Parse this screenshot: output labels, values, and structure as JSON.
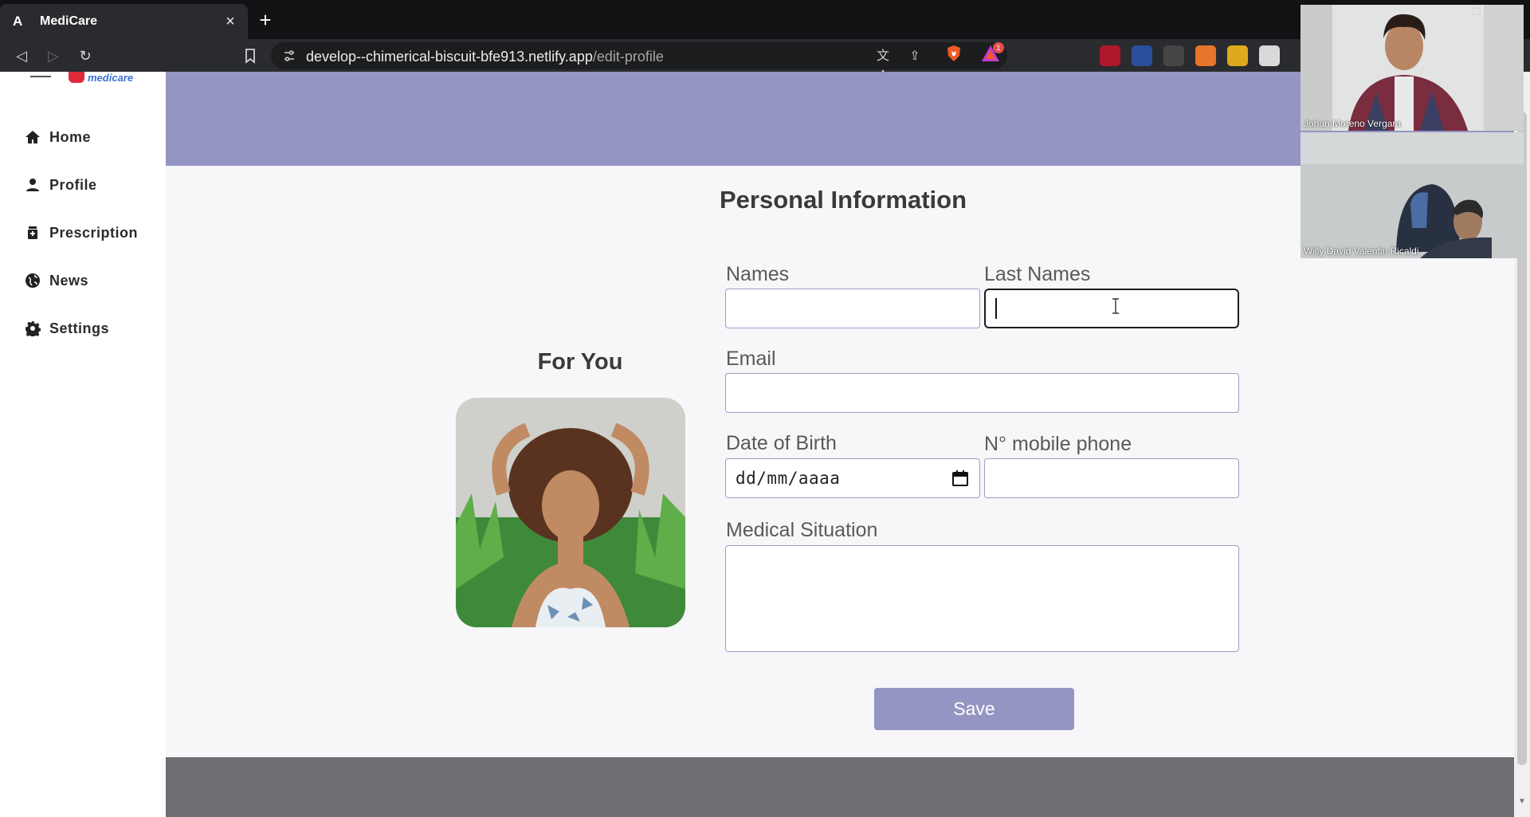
{
  "browser": {
    "tab": {
      "favicon": "A",
      "title": "MediCare",
      "close": "×"
    },
    "new_tab": "+",
    "nav": {
      "back": "◁",
      "forward": "▷",
      "reload": "↻"
    },
    "url": {
      "host": "develop--chimerical-biscuit-bfe913.netlify.app",
      "path": "/edit-profile"
    },
    "actions": {
      "translate": "文A",
      "share": "⇪"
    },
    "rewards_badge": "1"
  },
  "app": {
    "logo_text": "medicare",
    "sidebar": {
      "items": [
        {
          "label": "Home",
          "icon": "home-icon"
        },
        {
          "label": "Profile",
          "icon": "person-icon"
        },
        {
          "label": "Prescription",
          "icon": "prescription-icon"
        },
        {
          "label": "News",
          "icon": "globe-icon"
        },
        {
          "label": "Settings",
          "icon": "gear-icon"
        }
      ]
    },
    "section_title": "Personal Information",
    "for_you": {
      "title": "For You"
    },
    "form": {
      "names_label": "Names",
      "names_value": "",
      "last_names_label": "Last Names",
      "last_names_value": "",
      "email_label": "Email",
      "email_value": "",
      "dob_label": "Date of Birth",
      "dob_placeholder": "dd/mm/aaaa",
      "phone_label": "N° mobile phone",
      "phone_value": "",
      "medical_label": "Medical Situation",
      "medical_value": ""
    },
    "save_label": "Save"
  },
  "video_call": {
    "participants": [
      {
        "name": "Johan Moreno Vergara"
      },
      {
        "name": "Willy David Valentin Ricaldi"
      }
    ]
  },
  "colors": {
    "brand_purple": "#9595c3",
    "footer_gray": "#6f6e72",
    "browser_dark": "#2a2b2e"
  }
}
